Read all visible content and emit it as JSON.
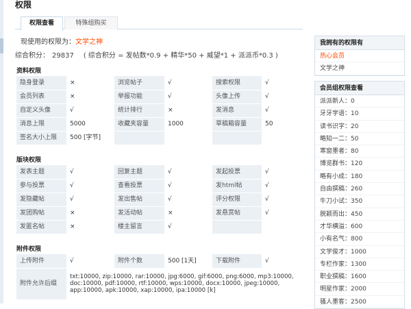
{
  "page_title": "权限",
  "tabs": [
    {
      "label": "权限查看",
      "active": true
    },
    {
      "label": "特殊组购买",
      "active": false
    }
  ],
  "current_permission": {
    "prefix": "现使用的权限为：",
    "role": "文学之神"
  },
  "score": {
    "label": "综合积分：",
    "value": "29837",
    "formula": "( 综合积分 = 发帖数*0.9 + 精华*50 + 威望*1 + 派派币*0.3 )"
  },
  "colors": {
    "accent_orange": "#ff4a00",
    "yes_green": "#2e8b2e",
    "no_red": "#e8402b",
    "key_cell_bg": "#ebf0f5"
  },
  "sections": {
    "resource": {
      "title": "资料权限",
      "rows": [
        [
          {
            "k": "隐身登录"
          },
          {
            "v": "×"
          },
          {
            "k": "浏览帖子"
          },
          {
            "v": "√"
          },
          {
            "k": "搜索权限"
          },
          {
            "v": "√"
          }
        ],
        [
          {
            "k": "会员列表"
          },
          {
            "v": "×"
          },
          {
            "k": "举报功能"
          },
          {
            "v": "√"
          },
          {
            "k": "头像上传"
          },
          {
            "v": "√"
          }
        ],
        [
          {
            "k": "自定义头像"
          },
          {
            "v": "√"
          },
          {
            "k": "统计排行"
          },
          {
            "v": "×"
          },
          {
            "k": "发消息"
          },
          {
            "v": "√"
          }
        ],
        [
          {
            "k": "消息上限"
          },
          {
            "v": "5000"
          },
          {
            "k": "收藏夹容量"
          },
          {
            "v": "1000"
          },
          {
            "k": "草稿箱容量"
          },
          {
            "v": "50"
          }
        ],
        [
          {
            "k": "签名大小上限"
          },
          {
            "v": "500 [字节]"
          }
        ]
      ]
    },
    "board": {
      "title": "版块权限",
      "rows": [
        [
          {
            "k": "发表主题"
          },
          {
            "v": "√"
          },
          {
            "k": "回复主题"
          },
          {
            "v": "√"
          },
          {
            "k": "发起投票"
          },
          {
            "v": "√"
          }
        ],
        [
          {
            "k": "参与投票"
          },
          {
            "v": "√"
          },
          {
            "k": "查看投票"
          },
          {
            "v": "√"
          },
          {
            "k": "发html帖"
          },
          {
            "v": "√"
          }
        ],
        [
          {
            "k": "发隐藏帖"
          },
          {
            "v": "√"
          },
          {
            "k": "发出售帖"
          },
          {
            "v": "√"
          },
          {
            "k": "评分权限"
          },
          {
            "v": "√"
          }
        ],
        [
          {
            "k": "发团购帖"
          },
          {
            "v": "×"
          },
          {
            "k": "发活动帖"
          },
          {
            "v": "×"
          },
          {
            "k": "发悬赏帖"
          },
          {
            "v": "√"
          }
        ],
        [
          {
            "k": "发匿名帖"
          },
          {
            "v": "×"
          },
          {
            "k": "楼主留言"
          },
          {
            "v": "√"
          }
        ]
      ]
    },
    "attachment": {
      "title": "附件权限",
      "row1": [
        {
          "k": "上传附件"
        },
        {
          "v": "√"
        },
        {
          "k": "附件个数"
        },
        {
          "v": "500 [1天]"
        },
        {
          "k": "下载附件"
        },
        {
          "v": "√"
        }
      ],
      "allowed_label": "附件允许后缀",
      "allowed_value": "txt:10000, zip:10000, rar:10000, jpg:6000, gif:6000, png:6000, mp3:10000, doc:10000, pdf:10000, rtf:10000, wps:10000, docx:10000, jpeg:10000, app:10000, apk:10000, xap:10000, ipa:10000 [k]"
    }
  },
  "sidebar": {
    "my_perms": {
      "title": "我拥有的权限有",
      "items": [
        {
          "label": "热心会员",
          "active": true
        },
        {
          "label": "文学之神",
          "active": false
        }
      ]
    },
    "member_groups": {
      "title": "会员组权限查看",
      "items": [
        "派派新人：0",
        "牙牙学语：10",
        "读书识字：20",
        "略知一二：50",
        "寒窗墨者：80",
        "博览群书：120",
        "略有小成：180",
        "自由撰稿：260",
        "牛刀小试：350",
        "脱颖而出：450",
        "才华横溢：600",
        "小有名气：800",
        "文学俊才：1000",
        "专栏作家：1300",
        "职业撰稿：1600",
        "明星作家：2000",
        "骚人墨客：2500"
      ]
    }
  }
}
